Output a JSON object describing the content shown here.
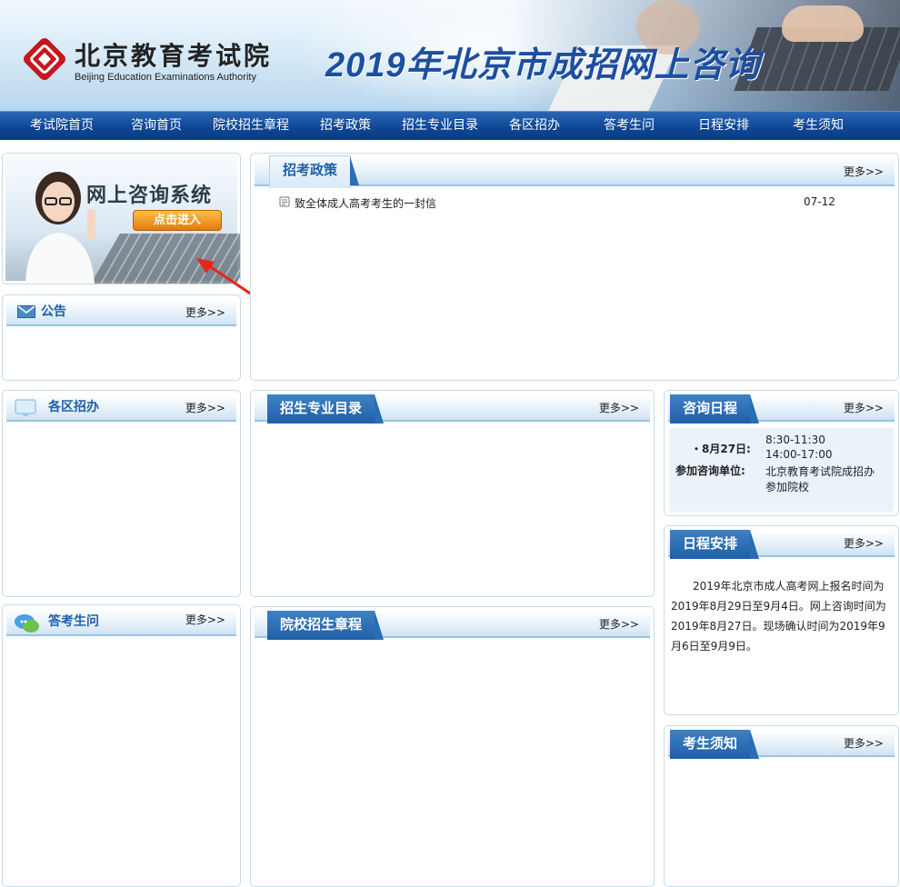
{
  "header": {
    "logo_cn": "北京教育考试院",
    "logo_en": "Beijing Education Examinations Authority",
    "banner_title": "2019年北京市成招网上咨询"
  },
  "nav": [
    "考试院首页",
    "咨询首页",
    "院校招生章程",
    "招考政策",
    "招生专业目录",
    "各区招办",
    "答考生问",
    "日程安排",
    "考生须知"
  ],
  "consult": {
    "title": "网上咨询系统",
    "button": "点击进入"
  },
  "more": "更多>>",
  "boxes": {
    "notice": "公告",
    "district": "各区招办",
    "qa": "答考生问",
    "policy": "招考政策",
    "majors": "招生专业目录",
    "charter": "院校招生章程",
    "consult_schedule": "咨询日程",
    "schedule": "日程安排",
    "must_know": "考生须知"
  },
  "policy_news": [
    {
      "title": "致全体成人高考考生的一封信",
      "date": "07-12"
    }
  ],
  "consult_schedule": {
    "date_label": "・8月27日:",
    "time1": "8:30-11:30",
    "time2": "14:00-17:00",
    "unit_label": "参加咨询单位:",
    "unit1": "北京教育考试院成招办",
    "unit2": "参加院校"
  },
  "schedule_text": "2019年北京市成人高考网上报名时间为2019年8月29日至9月4日。网上咨询时间为2019年8月27日。现场确认时间为2019年9月6日至9月9日。",
  "colors": {
    "nav": "#0e4797",
    "tab": "#1f5fa6",
    "border": "#c7dbe9",
    "button": "#e27a0d",
    "arrow": "#e8251a"
  }
}
